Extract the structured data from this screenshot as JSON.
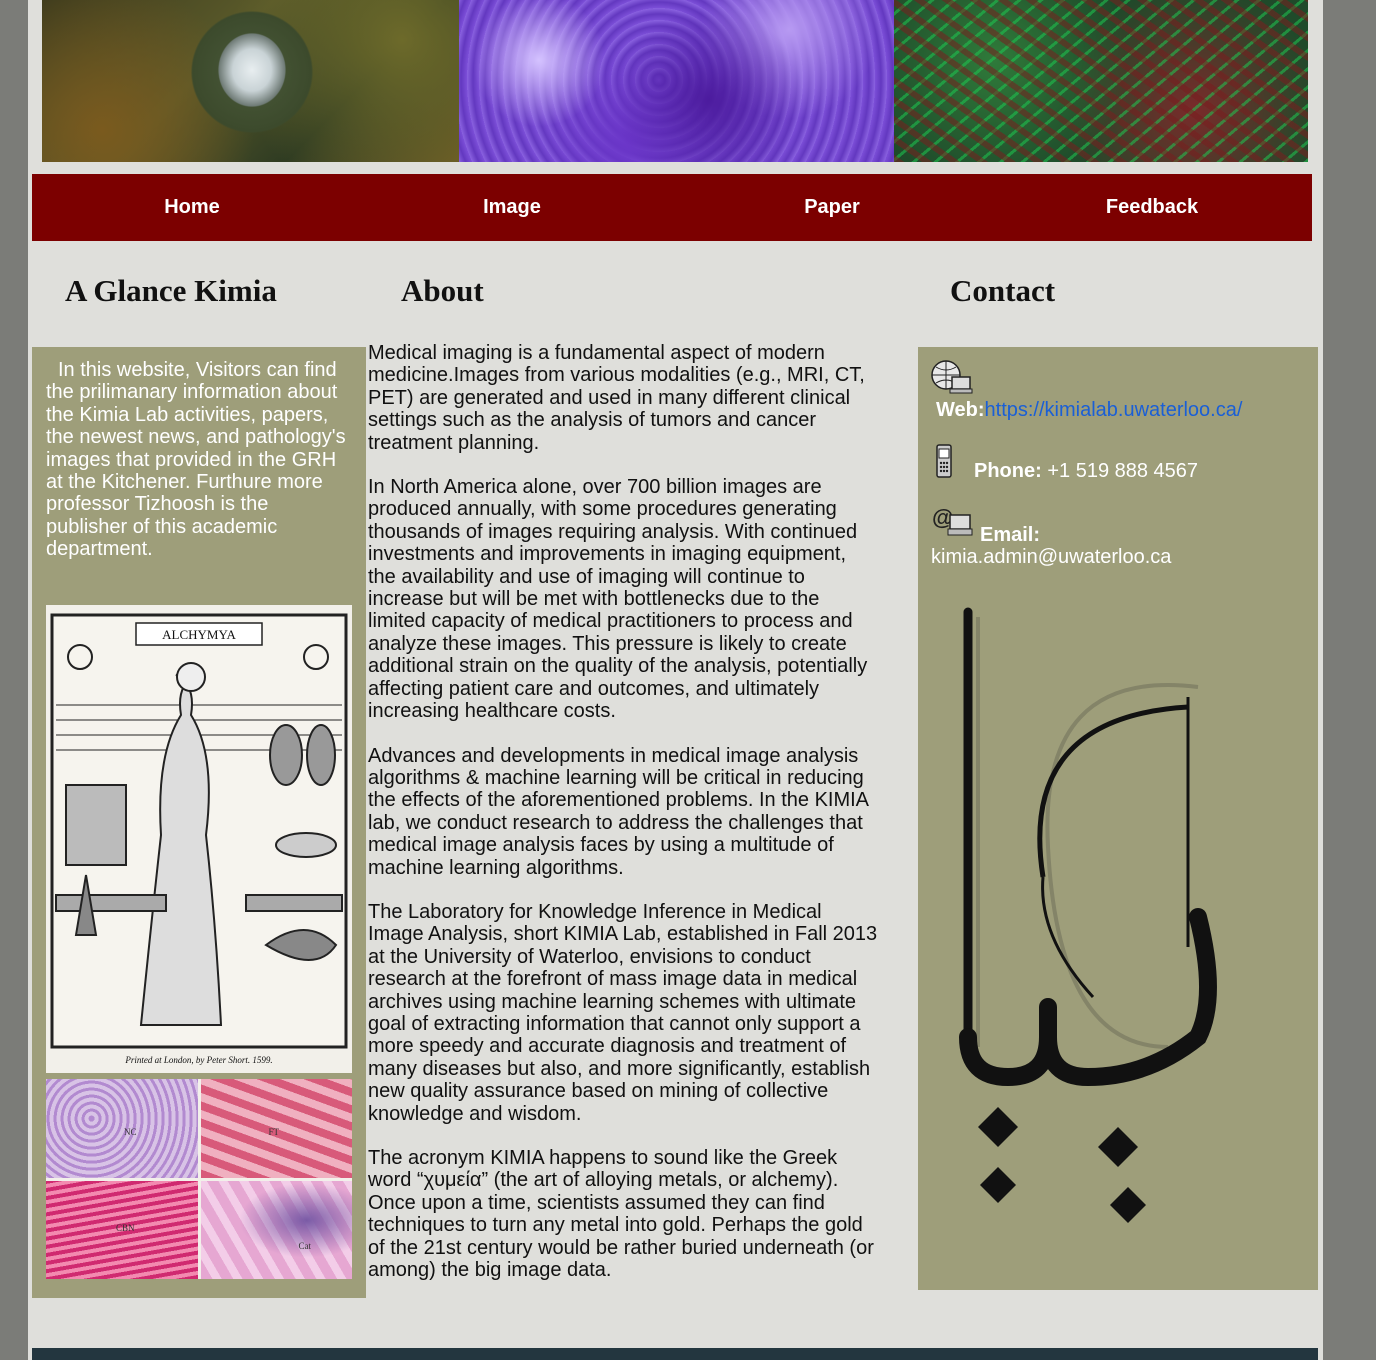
{
  "nav": {
    "items": [
      {
        "label": "Home"
      },
      {
        "label": "Image"
      },
      {
        "label": "Paper"
      },
      {
        "label": "Feedback"
      }
    ]
  },
  "left": {
    "heading": "A Glance Kimia",
    "intro": "In this website, Visitors can find the prilimanary information about the Kimia Lab activities, papers, the newest news, and pathology's images that provided in the GRH at the Kitchener. Furthure more professor Tizhoosh is the publisher of this academic department.",
    "alchymya_label": "ALCHYMYA",
    "alchymya_caption": "Printed at London, by Peter Short. 1599.",
    "histo_labels": [
      "NC",
      "FT",
      "CBN",
      "Cat"
    ]
  },
  "about": {
    "heading": "About",
    "paragraphs": [
      " Medical imaging is a fundamental aspect of modern medicine.Images from various modalities (e.g., MRI, CT, PET) are generated and used in many different clinical settings such as the analysis of tumors and cancer treatment planning.",
      " In North America alone, over 700 billion images are produced annually, with some procedures generating thousands of images requiring analysis. With continued investments and improvements in imaging equipment, the availability and use of imaging will continue to increase but will be met with bottlenecks due to the limited capacity of medical practitioners to process and analyze these images. This pressure is likely to create additional strain on the quality of the analysis, potentially affecting patient care and outcomes, and ultimately increasing healthcare costs.",
      " Advances and developments in medical image analysis algorithms & machine learning will be critical in reducing the effects of the aforementioned problems. In the KIMIA lab, we conduct research to address the challenges that medical image analysis faces by using a multitude of machine learning algorithms.",
      " The Laboratory for Knowledge Inference in Medical Image Analysis, short KIMIA Lab, established in Fall 2013 at the University of Waterloo, envisions to conduct research at the forefront of mass image data in medical archives using machine learning schemes with ultimate goal of extracting information that cannot only support a more speedy and accurate diagnosis and treatment of many diseases but also, and more significantly, establish new quality assurance based on mining of collective knowledge and wisdom.",
      " The acronym KIMIA happens to sound like the Greek word “χυμεία” (the art of alloying metals, or alchemy). Once upon a time, scientists assumed they can find techniques to turn any metal into gold. Perhaps the gold of the 21st century would be rather buried underneath (or among) the big image data."
    ]
  },
  "contact": {
    "heading": "Contact",
    "web_label": "Web:",
    "web_url": "https://kimialab.uwaterloo.ca/",
    "phone_label": "Phone:",
    "phone_value": "+1 519 888 4567",
    "email_label": "Email:",
    "email_value": "kimia.admin@uwaterloo.ca"
  }
}
